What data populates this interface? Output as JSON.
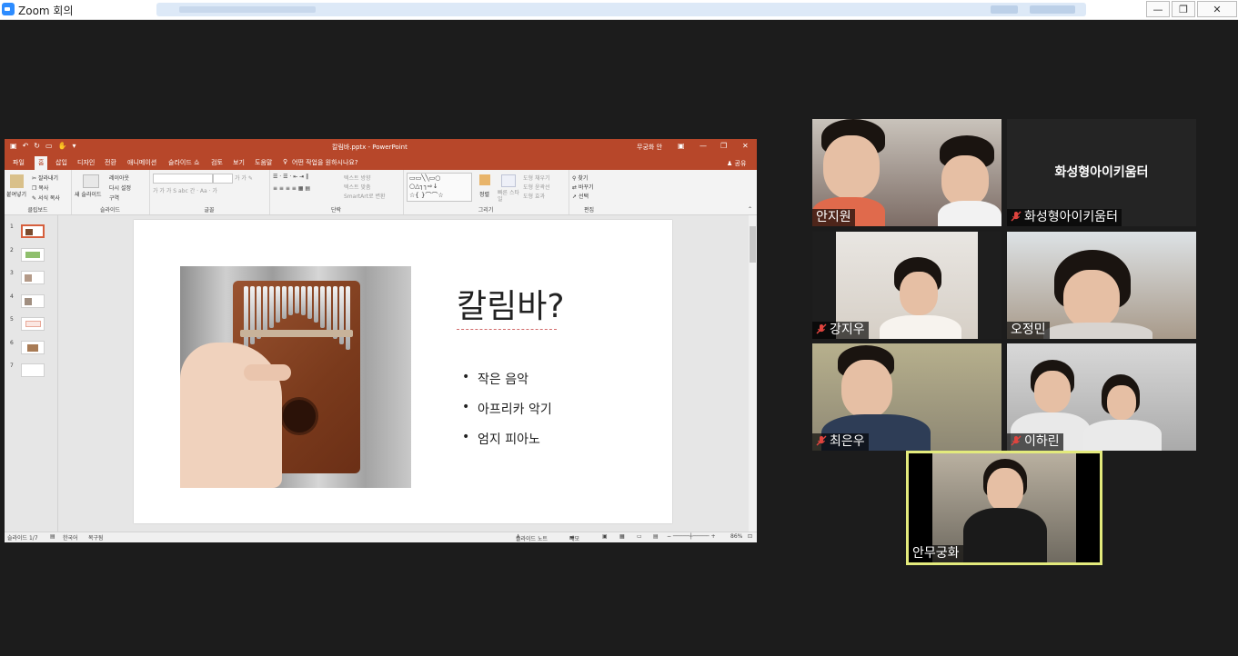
{
  "window": {
    "title": "Zoom 회의",
    "controls": {
      "minimize": "—",
      "restore": "❐",
      "close": "✕"
    }
  },
  "ppt": {
    "filename": "칼림바.pptx - PowerPoint",
    "signin": "무궁화 안",
    "share": "공유",
    "tabs": [
      "파일",
      "홈",
      "삽입",
      "디자인",
      "전환",
      "애니메이션",
      "슬라이드 쇼",
      "검토",
      "보기",
      "도움말"
    ],
    "tell_me": "어떤 작업을 원하시나요?",
    "ribbon": {
      "clipboard": {
        "paste": "붙여넣기",
        "cut": "잘라내기",
        "copy": "복사",
        "format_painter": "서식 복사",
        "label": "클립보드"
      },
      "slides": {
        "new_slide": "새 슬라이드",
        "layout": "레이아웃",
        "reset": "다시 설정",
        "section": "구역",
        "label": "슬라이드"
      },
      "font": {
        "label": "글꼴"
      },
      "paragraph": {
        "text_direction": "텍스트 방향",
        "align_text": "텍스트 맞춤",
        "smartart": "SmartArt로 변환",
        "label": "단락"
      },
      "drawing": {
        "arrange": "정렬",
        "quick_styles": "빠른 스타일",
        "shape_fill": "도형 채우기",
        "shape_outline": "도형 윤곽선",
        "shape_effects": "도형 효과",
        "label": "그리기"
      },
      "editing": {
        "find": "찾기",
        "replace": "바꾸기",
        "select": "선택",
        "label": "편집"
      }
    },
    "thumbnails": [
      "1",
      "2",
      "3",
      "4",
      "5",
      "6",
      "7"
    ],
    "slide": {
      "title": "칼림바?",
      "bullets": [
        "작은 음악",
        "아프리카 악기",
        "엄지 피아노"
      ]
    },
    "status": {
      "slide_count": "슬라이드 1/7",
      "language": "한국어",
      "recovery": "복구됨",
      "notes": "슬라이드 노트",
      "comments": "메모",
      "zoom": "86%"
    }
  },
  "participants": [
    {
      "name": "안지원",
      "muted": false
    },
    {
      "name": "화성형아이키움터",
      "muted": true,
      "video_off": true
    },
    {
      "name": "강지우",
      "muted": true
    },
    {
      "name": "오정민",
      "muted": false
    },
    {
      "name": "최은우",
      "muted": true
    },
    {
      "name": "이하린",
      "muted": true
    },
    {
      "name": "안무궁화",
      "muted": false,
      "active_speaker": true
    }
  ],
  "colors": {
    "ppt_accent": "#b7472a",
    "active_speaker_border": "#e3ea7c",
    "mute_icon": "#e0443e",
    "background": "#1c1c1c"
  }
}
